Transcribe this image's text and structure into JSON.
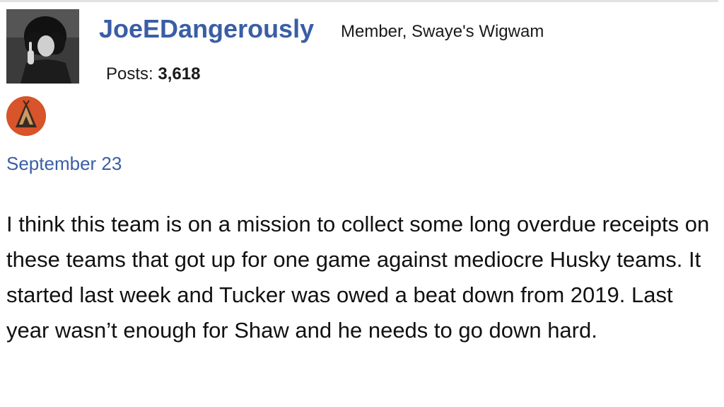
{
  "post": {
    "author": {
      "username": "JoeEDangerously",
      "role": "Member, Swaye's Wigwam",
      "posts_label": "Posts:",
      "posts_count": "3,618",
      "avatar_icon": "user-avatar-photo",
      "badge_icon": "wigwam-badge-icon"
    },
    "date": "September 23",
    "body": "I think this team is on a mission to collect some long overdue receipts on these teams that got up for one game against mediocre Husky teams. It started last week and Tucker was owed a beat down from 2019. Last year wasn’t enough for Shaw and he needs to go down hard."
  },
  "colors": {
    "link": "#3a5ea5",
    "badge": "#d8542a",
    "text": "#111111"
  }
}
